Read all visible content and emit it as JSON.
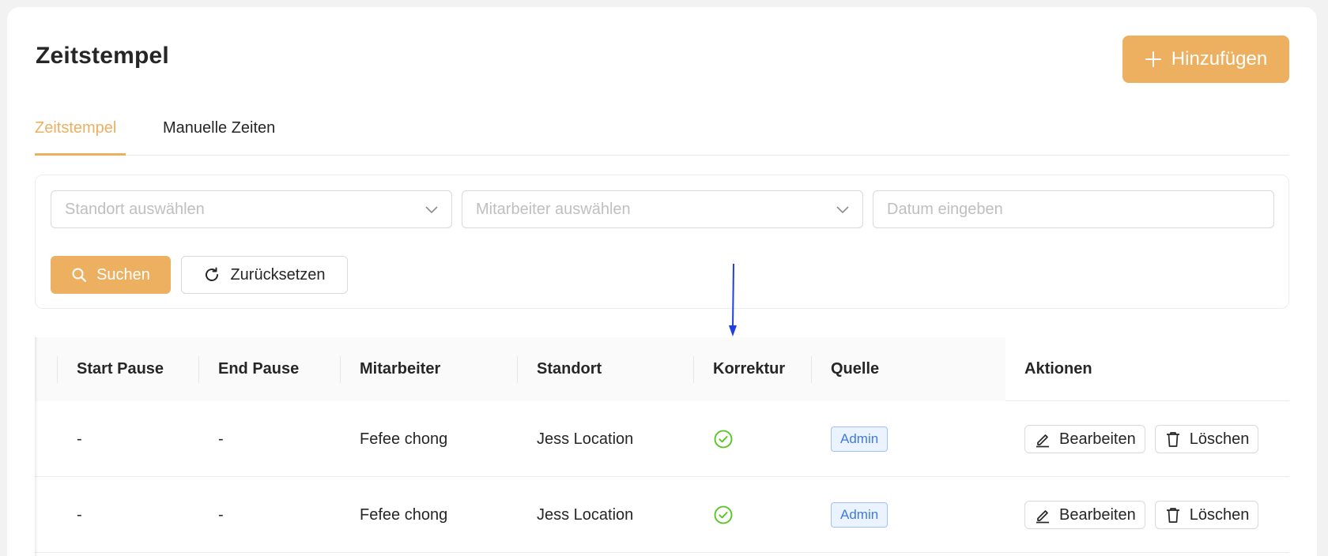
{
  "page": {
    "title": "Zeitstempel"
  },
  "header": {
    "add_label": "Hinzufügen"
  },
  "tabs": [
    {
      "label": "Zeitstempel",
      "active": true
    },
    {
      "label": "Manuelle Zeiten",
      "active": false
    }
  ],
  "filters": {
    "location_placeholder": "Standort auswählen",
    "employee_placeholder": "Mitarbeiter auswählen",
    "date_placeholder": "Datum eingeben",
    "search_label": "Suchen",
    "reset_label": "Zurücksetzen"
  },
  "table": {
    "columns": [
      "Start Pause",
      "End Pause",
      "Mitarbeiter",
      "Standort",
      "Korrektur",
      "Quelle",
      "Aktionen"
    ],
    "rows": [
      {
        "start_pause": "-",
        "end_pause": "-",
        "employee": "Fefee chong",
        "location": "Jess Location",
        "correction": "check-circle-icon",
        "source": "Admin",
        "edit_label": "Bearbeiten",
        "delete_label": "Löschen"
      },
      {
        "start_pause": "-",
        "end_pause": "-",
        "employee": "Fefee chong",
        "location": "Jess Location",
        "correction": "check-circle-icon",
        "source": "Admin",
        "edit_label": "Bearbeiten",
        "delete_label": "Löschen"
      }
    ]
  },
  "colors": {
    "accent": "#ecb060",
    "success": "#52c41a",
    "badge_text": "#3f7ae0",
    "annotation_arrow": "#1f3fe0"
  }
}
